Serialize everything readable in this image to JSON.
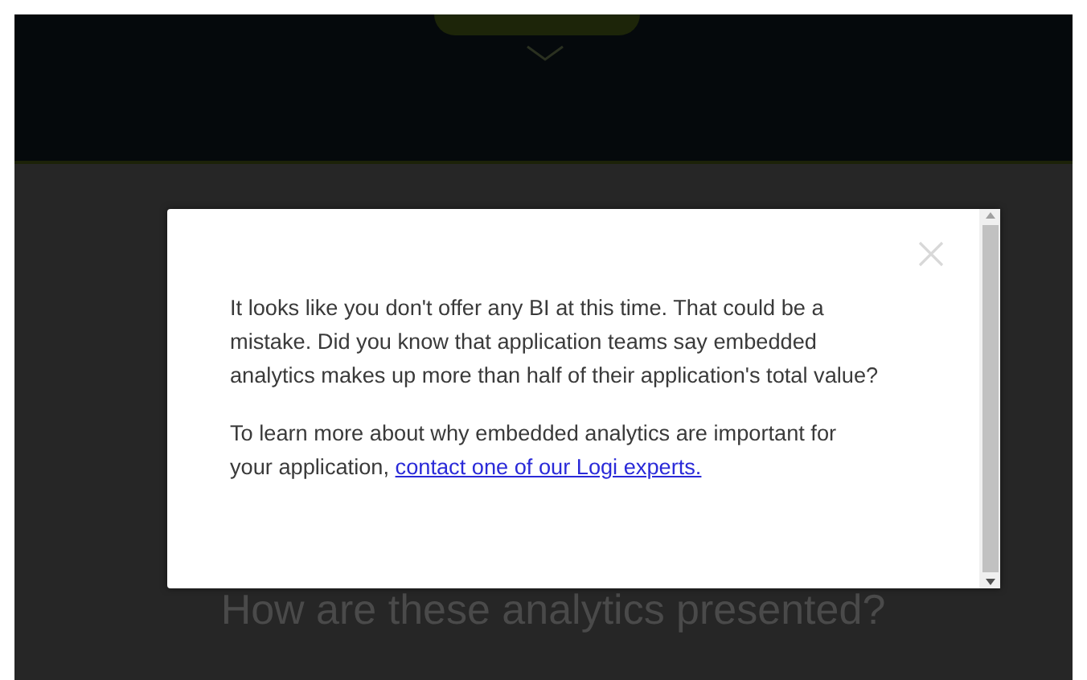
{
  "background": {
    "heading": "How are these analytics presented?"
  },
  "modal": {
    "paragraphs": [
      "It looks like you don't offer any BI at this time. That could be a mistake. Did you know that application teams say embedded analytics makes up more than half of their application's total value?"
    ],
    "closing": {
      "text": "To learn more about why embedded analytics are important for your application,",
      "link": "contact one of our Logi experts."
    }
  }
}
